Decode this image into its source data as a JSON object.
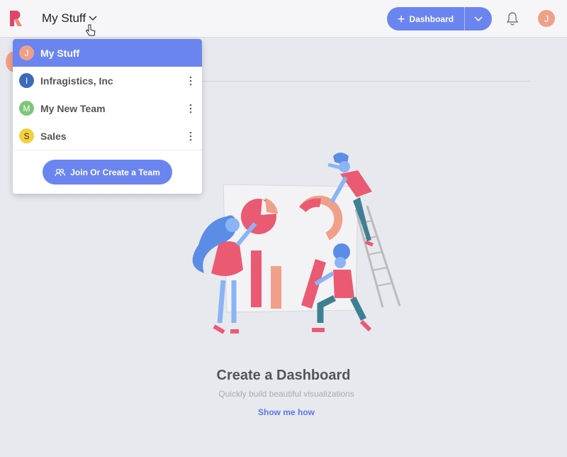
{
  "header": {
    "workspace_title": "My Stuff",
    "dashboard_button": "Dashboard",
    "user_initial": "J"
  },
  "dropdown": {
    "items": [
      {
        "initial": "J",
        "label": "My Stuff",
        "color": "#f0a089",
        "active": true
      },
      {
        "initial": "I",
        "label": "Infragistics, Inc",
        "color": "#3d6ab8"
      },
      {
        "initial": "M",
        "label": "My New Team",
        "color": "#7dc67a"
      },
      {
        "initial": "S",
        "label": "Sales",
        "color": "#f4d13a"
      }
    ],
    "join_button": "Join Or Create a Team"
  },
  "empty_state": {
    "title": "Create a Dashboard",
    "subtitle": "Quickly build beautiful visualizations",
    "link": "Show me how"
  },
  "colors": {
    "accent": "#6b85f0",
    "link": "#5b77e8",
    "illustration_pink": "#ea5a72",
    "illustration_salmon": "#f0a089",
    "illustration_blue": "#5b8ce6"
  }
}
